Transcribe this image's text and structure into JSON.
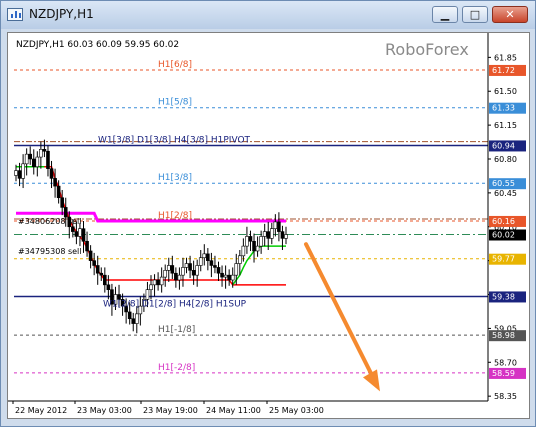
{
  "window": {
    "title": "NZDJPY,H1",
    "buttons": {
      "minimize": "▁",
      "maximize": "□",
      "close": "✕"
    }
  },
  "chart_info": {
    "symbol_line": "NZDJPY,H1  60.03 60.09 59.95 60.02",
    "watermark": "RoboForex"
  },
  "chart_data": {
    "type": "candlestick",
    "symbol": "NZDJPY",
    "timeframe": "H1",
    "ohlc": {
      "open": 60.03,
      "high": 60.09,
      "low": 59.95,
      "close": 60.02
    },
    "ylim": [
      58.3,
      62.05
    ],
    "y_ticks": [
      "61.85",
      "61.50",
      "61.15",
      "60.80",
      "60.45",
      "60.10",
      "59.75",
      "59.40",
      "59.05",
      "58.70",
      "58.35"
    ],
    "x_ticks": [
      "22 May 2012",
      "23 May 03:00",
      "23 May 19:00",
      "24 May 11:00",
      "25 May 03:00"
    ],
    "levels": [
      {
        "label": "H1[6/8]",
        "value": 61.72,
        "price": "61.72",
        "color": "#e8562a",
        "style": "dash"
      },
      {
        "label": "H1[5/8]",
        "value": 61.33,
        "price": "61.33",
        "color": "#3a8ed8",
        "style": "dash"
      },
      {
        "label": "W1[3/8] D1[3/8] H4[3/8] H1PIVOT",
        "value": 60.94,
        "price": "60.94",
        "color": "#1a237e",
        "style": "solid"
      },
      {
        "label": "H1[3/8]",
        "value": 60.55,
        "price": "60.55",
        "color": "#3a8ed8",
        "style": "dash"
      },
      {
        "label": "H1[2/8]",
        "value": 60.16,
        "price": "60.16",
        "color": "#e8562a",
        "style": "dash"
      },
      {
        "label": "",
        "value": 60.02,
        "price": "60.02",
        "color": "#000000",
        "style": "current"
      },
      {
        "label": "",
        "value": 59.77,
        "price": "59.77",
        "color": "#e8b400",
        "style": "dash"
      },
      {
        "label": "W1[2/8] D1[2/8] H4[2/8] H1SUP",
        "value": 59.38,
        "price": "59.38",
        "color": "#1a237e",
        "style": "solid"
      },
      {
        "label": "H1[-1/8]",
        "value": 58.98,
        "price": "58.98",
        "color": "#555555",
        "style": "dash"
      },
      {
        "label": "H1[-2/8]",
        "value": 58.59,
        "price": "58.59",
        "color": "#d633c4",
        "style": "dash"
      }
    ],
    "side_labels": [
      {
        "text": "#34806208 sell",
        "value": 60.16
      },
      {
        "text": "#34795308 sell",
        "value": 59.85
      }
    ],
    "close": [
      60.68,
      60.6,
      60.75,
      60.85,
      60.8,
      60.72,
      60.82,
      60.9,
      60.88,
      60.7,
      60.6,
      60.52,
      60.4,
      60.3,
      60.2,
      60.1,
      60.05,
      60.0,
      60.08,
      59.95,
      59.85,
      59.75,
      59.7,
      59.62,
      59.6,
      59.5,
      59.45,
      59.3,
      59.4,
      59.35,
      59.28,
      59.22,
      59.15,
      59.1,
      59.2,
      59.28,
      59.35,
      59.45,
      59.5,
      59.55,
      59.5,
      59.58,
      59.65,
      59.7,
      59.62,
      59.55,
      59.6,
      59.68,
      59.72,
      59.65,
      59.6,
      59.7,
      59.78,
      59.82,
      59.75,
      59.7,
      59.68,
      59.62,
      59.58,
      59.6,
      59.55,
      59.6,
      59.72,
      59.8,
      59.9,
      60.0,
      59.95,
      59.85,
      59.9,
      60.0,
      60.05,
      59.98,
      60.08,
      60.15,
      60.05,
      59.98,
      60.02
    ],
    "h1_resistance_line": [
      60.24,
      60.24,
      60.24,
      60.24,
      60.24,
      60.24,
      60.24,
      60.24,
      60.24,
      60.24,
      60.24,
      60.24,
      60.24,
      60.24,
      60.24,
      60.24,
      60.24,
      60.24,
      60.24,
      60.24,
      60.24,
      60.24,
      60.24,
      60.16,
      60.16,
      60.16,
      60.16,
      60.16,
      60.16,
      60.16,
      60.16,
      60.16,
      60.16,
      60.16,
      60.16,
      60.16,
      60.16,
      60.16,
      60.16,
      60.16,
      60.16,
      60.16,
      60.16,
      60.16,
      60.16,
      60.16,
      60.16,
      60.16,
      60.16,
      60.16,
      60.16,
      60.16,
      60.16,
      60.16,
      60.16,
      60.16,
      60.16,
      60.16,
      60.16,
      60.16,
      60.16,
      60.16,
      60.16,
      60.16,
      60.16,
      60.16,
      60.16,
      60.16,
      60.16,
      60.16,
      60.16,
      60.16,
      60.16,
      60.16,
      60.16,
      60.16,
      60.16
    ],
    "red_trend": [
      60.72,
      60.72,
      60.72,
      60.72,
      60.72,
      60.72,
      60.72,
      60.72,
      60.72,
      60.72,
      60.72,
      60.6,
      60.5,
      60.38,
      60.28,
      60.18,
      60.1,
      60.05,
      60.0,
      59.95,
      59.88,
      59.8,
      59.72,
      59.65,
      59.6,
      59.55,
      59.55,
      59.55,
      59.55,
      59.55,
      59.55,
      59.55,
      59.55,
      59.55,
      59.55,
      59.55,
      59.55,
      59.55,
      59.55,
      59.55,
      59.55,
      59.55,
      59.55,
      59.55,
      59.55,
      59.55,
      59.55,
      59.55,
      59.55,
      59.55,
      59.55,
      59.55,
      59.55,
      59.55,
      59.55,
      59.55,
      59.55,
      59.55,
      59.55,
      59.55,
      59.55,
      59.5,
      59.5,
      59.5,
      59.5,
      59.5,
      59.5,
      59.5,
      59.5,
      59.5,
      59.5,
      59.5,
      59.5,
      59.5,
      59.5,
      59.5,
      59.5
    ],
    "green_trend": [
      60.72,
      60.72,
      60.72,
      60.72,
      60.72,
      60.72,
      60.72,
      60.72,
      60.72,
      null,
      null,
      null,
      null,
      null,
      null,
      null,
      null,
      null,
      null,
      null,
      null,
      null,
      null,
      null,
      null,
      null,
      null,
      null,
      null,
      null,
      null,
      null,
      null,
      null,
      null,
      null,
      null,
      null,
      null,
      null,
      null,
      null,
      null,
      null,
      null,
      null,
      null,
      null,
      null,
      null,
      null,
      null,
      null,
      null,
      null,
      null,
      null,
      null,
      null,
      null,
      null,
      59.5,
      59.55,
      59.6,
      59.68,
      59.75,
      59.8,
      59.85,
      59.88,
      59.9,
      59.9,
      59.9,
      59.9,
      59.9,
      59.9,
      59.9,
      59.9
    ],
    "arrow": {
      "from_value": 59.92,
      "to_value": 58.4
    }
  }
}
